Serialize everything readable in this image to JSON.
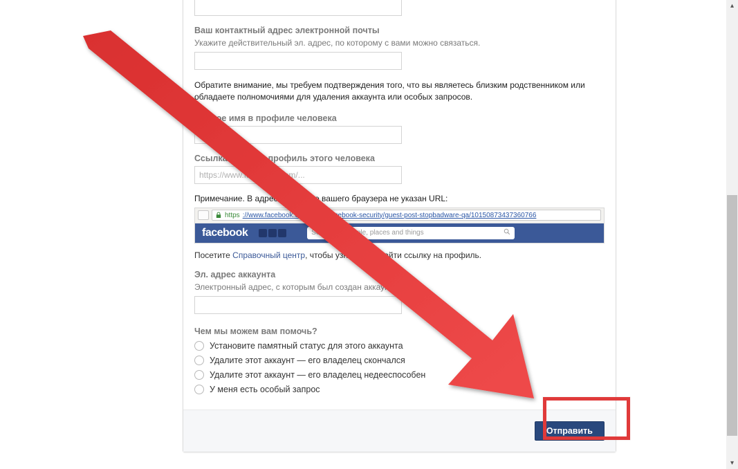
{
  "form": {
    "contact_email_label": "Ваш контактный адрес электронной почты",
    "contact_email_help": "Укажите действительный эл. адрес, по которому с вами можно связаться.",
    "notice_text": "Обратите внимание, мы требуем подтверждения того, что вы являетесь близким родственником или обладаете полномочиями для удаления аккаунта или особых запросов.",
    "person_name_label": "Полное имя в профиле человека",
    "profile_url_label": "Ссылка (URL) на профиль этого человека",
    "profile_url_placeholder": "https://www.facebook.com/...",
    "url_note_text": "Примечание. В адресной строке вашего браузера не указан URL:",
    "demo_url_scheme": "https",
    "demo_url_text": "://www.facebook.com/notes/facebook-security/guest-post-stopbadware-qa/10150873437360766",
    "demo_logo": "facebook",
    "demo_search_placeholder": "Search for people, places and things",
    "help_link_prefix": "Посетите ",
    "help_link_text": "Справочный центр",
    "help_link_suffix": ", чтобы узнать, как найти ссылку на профиль.",
    "account_email_label": "Эл. адрес аккаунта",
    "account_email_help": "Электронный адрес, с которым был создан аккаунт",
    "help_question_label": "Чем мы можем вам помочь?",
    "radio_options": [
      "Установите памятный статус для этого аккаунта",
      "Удалите этот аккаунт — его владелец скончался",
      "Удалите этот аккаунт — его владелец недееспособен",
      "У меня есть особый запрос"
    ],
    "submit_label": "Отправить"
  }
}
